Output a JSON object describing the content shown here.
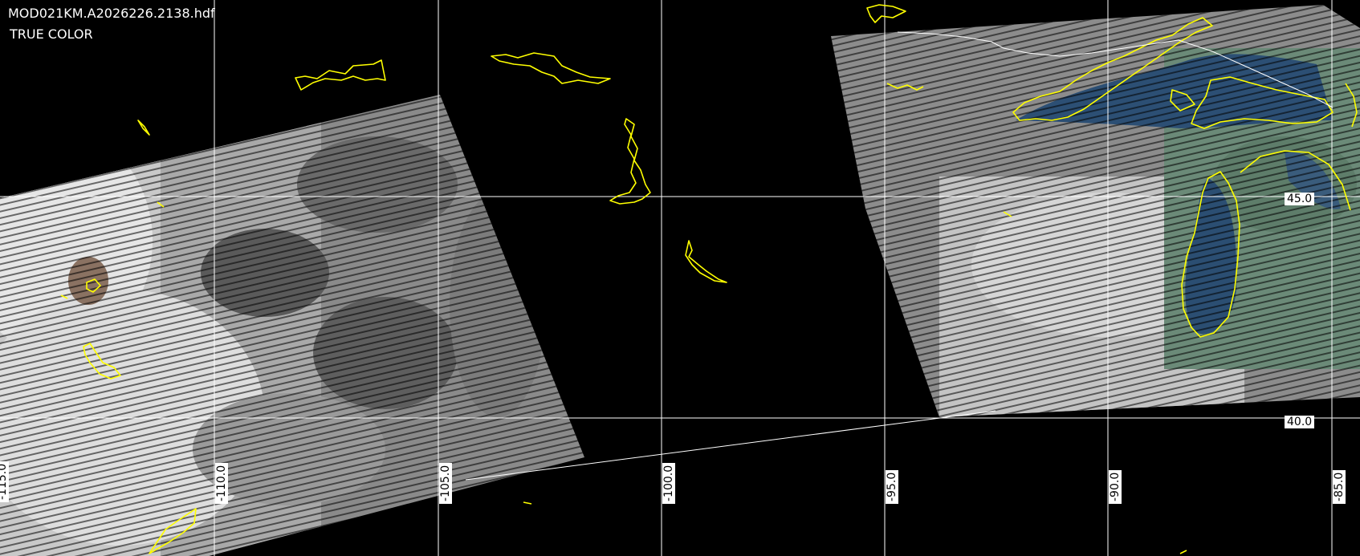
{
  "header": {
    "filename": "MOD021KM.A2026226.2138.hdf",
    "product": "TRUE COLOR"
  },
  "graticule": {
    "longitudes": [
      "-115.0",
      "-110.0",
      "-105.0",
      "-100.0",
      "-95.0",
      "-90.0",
      "-85.0"
    ],
    "latitudes": [
      "45.0",
      "40.0"
    ],
    "line_color": "#ffffff"
  },
  "coastline_color": "#ffff00",
  "border_color": "#ffffff",
  "cloud_color": "#e8e8e8"
}
